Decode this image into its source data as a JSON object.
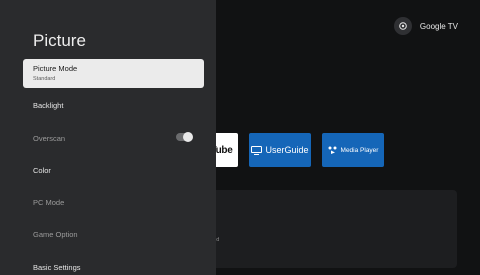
{
  "brand": {
    "label": "Google TV",
    "icon": "google-tv-icon"
  },
  "home": {
    "tiles": [
      {
        "label": "Tube",
        "icon": "youtube-icon"
      },
      {
        "label": "UserGuide",
        "icon": "monitor-icon"
      },
      {
        "label": "Media Player",
        "icon": "media-player-icon"
      }
    ],
    "card_text": "alized"
  },
  "panel": {
    "title": "Picture",
    "selected": {
      "label": "Picture Mode",
      "value": "Standard"
    },
    "items": [
      {
        "label": "Backlight"
      },
      {
        "label": "Overscan",
        "toggle": true
      },
      {
        "label": "Color"
      },
      {
        "label": "PC Mode"
      },
      {
        "label": "Game Option"
      },
      {
        "label": "Basic Settings"
      }
    ]
  },
  "colors": {
    "accent": "#1566b8",
    "panel": "#2a2b2d",
    "selected": "#ebebeb"
  }
}
